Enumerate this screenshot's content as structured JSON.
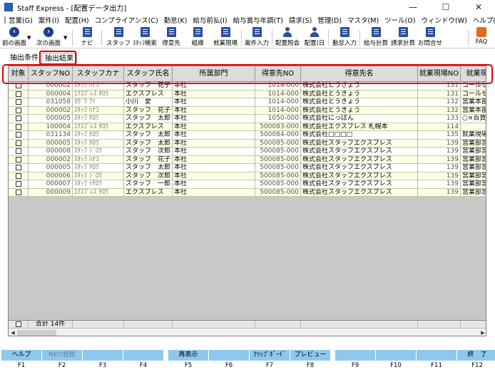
{
  "window": {
    "title": "Staff Express - [配置データ出力]",
    "minimize": "—",
    "maximize": "☐",
    "close": "✕"
  },
  "menu": [
    "営業(G)",
    "案件(I)",
    "配置(H)",
    "コンプライアンス(C)",
    "勤怠(K)",
    "給与前払(I)",
    "給与賞与年調(T)",
    "請求(S)",
    "管理(D)",
    "マスタ(M)",
    "ツール(O)",
    "ウィンドウ(W)",
    "ヘルプ(H)"
  ],
  "toolbar": {
    "prev": "前の画面",
    "next": "次の画面",
    "navi": "ナビ",
    "staff": "スタッフ",
    "staff_search": "ｽﾀｯﾌ検索",
    "client": "得意先",
    "org": "組織",
    "site": "就業現場",
    "case_input": "案件入力",
    "assign_ref": "配置照会",
    "assign_day": "配置(日",
    "attend_input": "勤怠入力",
    "salary_calc": "給与計算",
    "billing_calc": "請求計算",
    "inquiry": "お問合せ",
    "faq": "FAQ"
  },
  "tabs": {
    "conditions": "抽出条件",
    "results": "抽出結果"
  },
  "grid": {
    "columns": [
      "対象",
      "スタッフNO",
      "スタッフカナ",
      "スタッフ氏名",
      "所属部門",
      "得意先NO",
      "得意先名",
      "就業現場NO",
      "就業現場名"
    ],
    "rows": [
      [
        "",
        "000002",
        "ｽﾀｯﾌ ﾊﾅｺ",
        "スタッフ　花子",
        "本社",
        "1014-000",
        "株式会社とうきょう",
        "131",
        "コールセンター"
      ],
      [
        "",
        "000004",
        "ｴｸｽﾌﾟﾚｽ ﾀﾛｳ",
        "エクスプレス",
        "本社",
        "1014-000",
        "株式会社とうきょう",
        "131",
        "コールセンター"
      ],
      [
        "",
        "031058",
        "ｵｶﾞﾜ ｱｲ",
        "小川　愛",
        "本社",
        "1014-000",
        "株式会社とうきょう",
        "132",
        "営業本部"
      ],
      [
        "",
        "000002",
        "ｽﾀｯﾌ ﾊﾅｺ",
        "スタッフ　花子",
        "本社",
        "1014-000",
        "株式会社とうきょう",
        "132",
        "営業本部"
      ],
      [
        "",
        "000005",
        "ｽﾀｯﾌ ﾀﾛｳ",
        "スタッフ　太郎",
        "本社",
        "1050-000",
        "株式会社にっぽん",
        "133",
        "○×百貨店"
      ],
      [
        "",
        "100004",
        "ｴｸｽﾌﾟﾚｽ ﾀﾛｳ",
        "エクスプレス",
        "本社",
        "500083-000",
        "株式会社エクスプレス 札幌本",
        "114",
        ""
      ],
      [
        "",
        "031134",
        "ｽﾀｯﾌ ﾀﾛｳ",
        "スタッフ　太郎",
        "本社",
        "500084-000",
        "株式会社□□□□",
        "135",
        "就業現場"
      ],
      [
        "",
        "000005",
        "ｽﾀｯﾌ ﾀﾛｳ",
        "スタッフ　太郎",
        "本社",
        "500085-000",
        "株式会社スタッフエクスプレス",
        "139",
        "営業部営業課"
      ],
      [
        "",
        "000008",
        "ｽﾀｯﾌ ｼﾞﾛｳ",
        "スタッフ　次郎",
        "本社",
        "500085-000",
        "株式会社スタッフエクスプレス",
        "139",
        "営業部営業課"
      ],
      [
        "",
        "000002",
        "ｽﾀｯﾌ ﾊﾅｺ",
        "スタッフ　花子",
        "本社",
        "500085-000",
        "株式会社スタッフエクスプレス",
        "139",
        "営業部営業課"
      ],
      [
        "",
        "000005",
        "ｽﾀｯﾌ ﾀﾛｳ",
        "スタッフ　太郎",
        "本社",
        "500085-000",
        "株式会社スタッフエクスプレス",
        "139",
        "営業部営業課"
      ],
      [
        "",
        "000006",
        "ｽﾀｯﾌ ｼﾞﾛｳ",
        "スタッフ　次郎",
        "本社",
        "500085-000",
        "株式会社スタッフエクスプレス",
        "139",
        "営業部営業課"
      ],
      [
        "",
        "000007",
        "ｽﾀｯﾌ ｲﾁﾛｳ",
        "スタッフ　一郎",
        "本社",
        "500085-000",
        "株式会社スタッフエクスプレス",
        "139",
        "営業部営業課"
      ],
      [
        "",
        "000009",
        "ｴｸｽﾌﾟﾚｽ ﾀﾛｳ",
        "エクスプレス",
        "本社",
        "500085-000",
        "株式会社スタッフエクスプレス",
        "139",
        "営業部営業課"
      ]
    ],
    "total_label": "合計",
    "total_count": "14件"
  },
  "fkeys": [
    {
      "label": "ヘルプ",
      "key": "F1",
      "enabled": true
    },
    {
      "label": "NEO登録",
      "key": "F2",
      "enabled": false
    },
    {
      "label": "",
      "key": "F3",
      "enabled": true
    },
    {
      "label": "",
      "key": "F4",
      "enabled": true
    },
    {
      "label": "再表示",
      "key": "F5",
      "enabled": true
    },
    {
      "label": "",
      "key": "F6",
      "enabled": true
    },
    {
      "label": "ｸﾘｯﾌﾟﾎﾞｰﾄﾞ",
      "key": "F7",
      "enabled": true
    },
    {
      "label": "プレビュー",
      "key": "F8",
      "enabled": true
    },
    {
      "label": "",
      "key": "F9",
      "enabled": true
    },
    {
      "label": "",
      "key": "F10",
      "enabled": true
    },
    {
      "label": "",
      "key": "F11",
      "enabled": true
    },
    {
      "label": "終　了",
      "key": "F12",
      "enabled": true
    }
  ],
  "colors": {
    "fkey_bg": "#8ec8ee",
    "highlight": "#e00000",
    "row_alt": "#ffffe8"
  }
}
